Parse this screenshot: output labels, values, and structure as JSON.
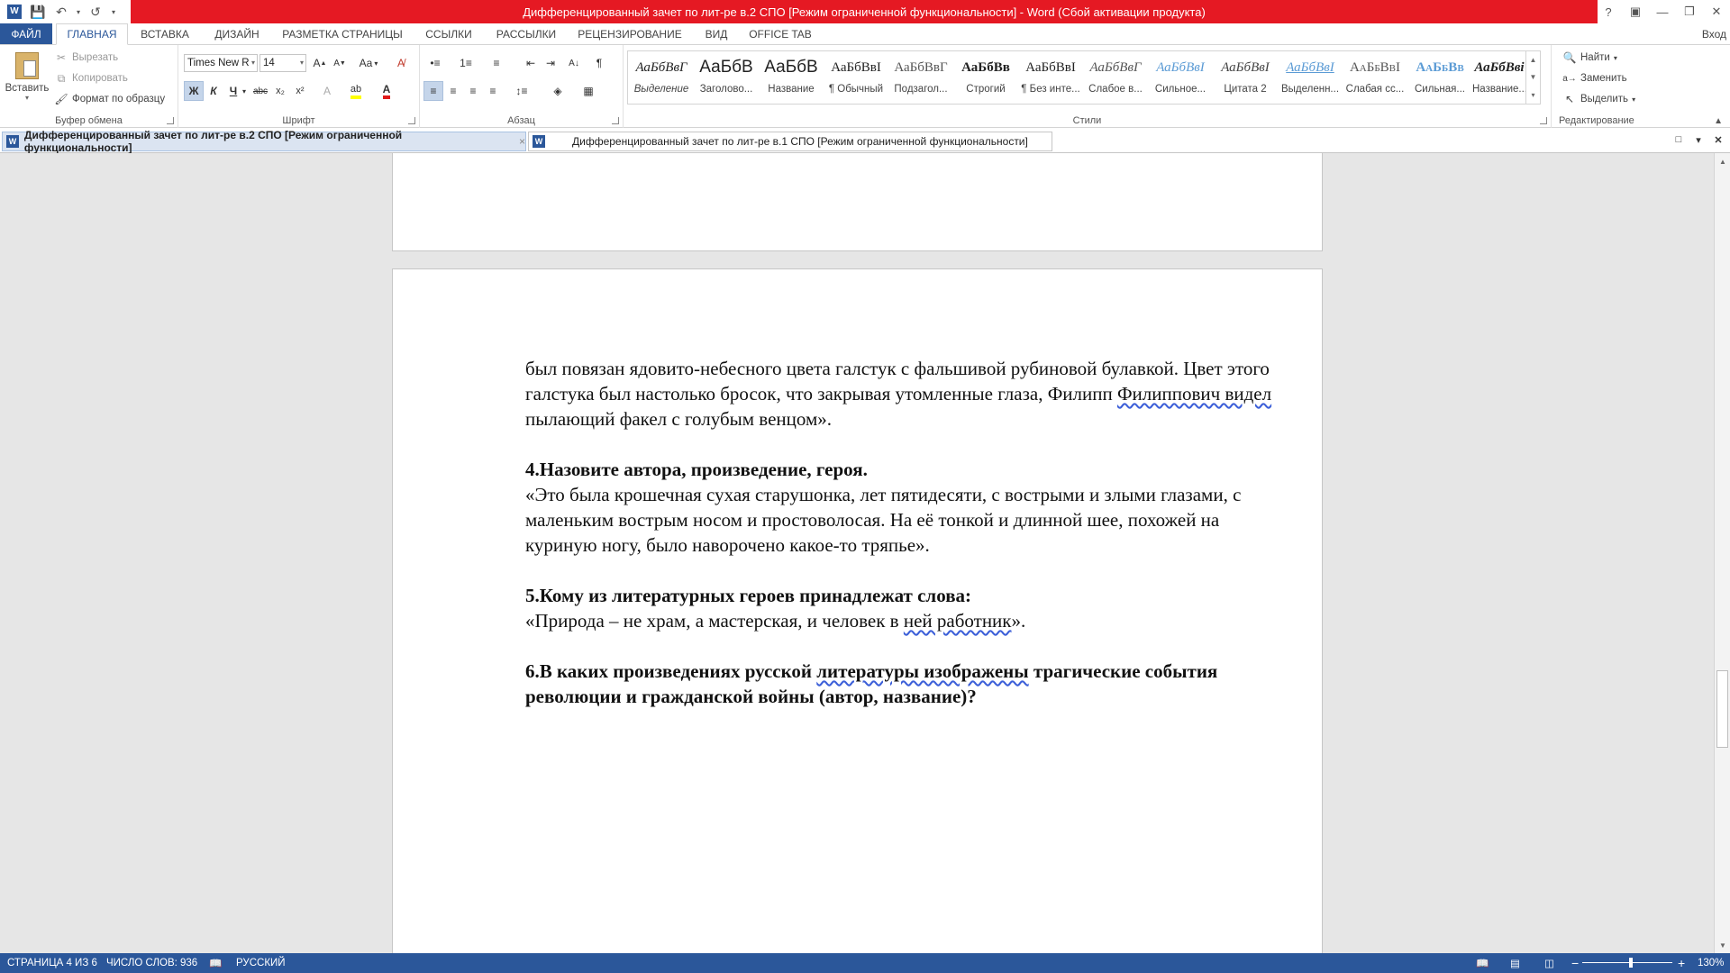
{
  "window": {
    "title": "Дифференцированный зачет по лит-ре  в.2 СПО [Режим ограниченной функциональности]  -  Word (Сбой активации продукта)",
    "help": "?",
    "sign_in": "Вход"
  },
  "ribbon_tabs": [
    "ФАЙЛ",
    "ГЛАВНАЯ",
    "ВСТАВКА",
    "ДИЗАЙН",
    "РАЗМЕТКА СТРАНИЦЫ",
    "ССЫЛКИ",
    "РАССЫЛКИ",
    "РЕЦЕНЗИРОВАНИЕ",
    "ВИД",
    "OFFICE TAB"
  ],
  "clipboard": {
    "paste": "Вставить",
    "cut": "Вырезать",
    "copy": "Копировать",
    "format_painter": "Формат по образцу",
    "label": "Буфер обмена"
  },
  "font": {
    "name": "Times New R",
    "size": "14",
    "change_case": "Aa",
    "bold": "Ж",
    "italic": "К",
    "underline": "Ч",
    "strike": "abc",
    "subscript": "x₂",
    "superscript": "x²",
    "label": "Шрифт"
  },
  "paragraph": {
    "label": "Абзац"
  },
  "styles": {
    "label": "Стили",
    "items": [
      {
        "preview": "АаБбВвГ",
        "label": "Выделение"
      },
      {
        "preview": "АаБбВ",
        "label": "Заголово..."
      },
      {
        "preview": "АаБбВ",
        "label": "Название"
      },
      {
        "preview": "АаБбВвІ",
        "label": "¶ Обычный"
      },
      {
        "preview": "АаБбВвГ",
        "label": "Подзагол..."
      },
      {
        "preview": "АаБбВв",
        "label": "Строгий"
      },
      {
        "preview": "АаБбВвІ",
        "label": "¶ Без инте..."
      },
      {
        "preview": "АаБбВвГ",
        "label": "Слабое в..."
      },
      {
        "preview": "АаБбВвІ",
        "label": "Сильное..."
      },
      {
        "preview": "АаБбВвІ",
        "label": "Цитата 2"
      },
      {
        "preview": "АаБбВвІ",
        "label": "Выделенн..."
      },
      {
        "preview": "АаБбВвІ",
        "label": "Слабая сс..."
      },
      {
        "preview": "АаБбВв",
        "label": "Сильная..."
      },
      {
        "preview": "АаБбВві",
        "label": "Название..."
      }
    ]
  },
  "editing": {
    "find": "Найти",
    "replace": "Заменить",
    "select": "Выделить",
    "label": "Редактирование"
  },
  "doc_tabs": [
    {
      "title": "Дифференцированный зачет по лит-ре  в.2 СПО [Режим ограниченной функциональности]",
      "close": "×"
    },
    {
      "title": "Дифференцированный зачет по лит-ре  в.1 СПО [Режим ограниченной функциональности]"
    }
  ],
  "document": {
    "p1_a": "был повязан ядовито-небесного цвета галстук с фальшивой рубиновой булавкой. Цвет этого галстука был настолько бросок, что закрывая утомленные глаза, Филипп ",
    "p1_sq": "Филиппович  видел",
    "p1_b": " пылающий факел с голубым венцом».",
    "q4_title": "4.Назовите автора, произведение, героя.",
    "q4_text": "«Это была крошечная сухая старушонка, лет пятидесяти, с вострыми и злыми глазами, с маленьким вострым носом и простоволосая. На её тонкой и длинной шее, похожей на куриную ногу, было наворочено какое-то тряпье».",
    "q5_title": "5.Кому из литературных героев принадлежат слова:",
    "q5_a": "«Природа – не храм, а мастерская, и человек в ",
    "q5_sq": "ней  работник",
    "q5_b": "».",
    "q6_a": "6.В каких произведениях русской ",
    "q6_sq": "литературы  изображены",
    "q6_b": " трагические события революции и гражданской войны  (автор, название)?"
  },
  "status": {
    "page": "СТРАНИЦА 4 ИЗ 6",
    "words": "ЧИСЛО СЛОВ: 936",
    "language": "РУССКИЙ",
    "zoom_minus": "−",
    "zoom_plus": "+",
    "zoom": "130%",
    "zoom_level": 130
  },
  "colors": {
    "title_bar": "#e51923",
    "accent": "#2b579a"
  }
}
